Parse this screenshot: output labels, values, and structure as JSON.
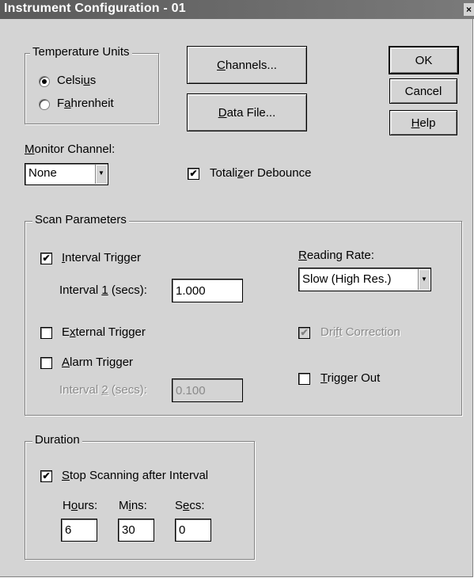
{
  "window": {
    "title": "Instrument Configuration - 01",
    "close_glyph": "×"
  },
  "temperature_units": {
    "legend": "Temperature Units",
    "celsius_pre": "Celsi",
    "celsius_key": "u",
    "celsius_post": "s",
    "fahrenheit_pre": "F",
    "fahrenheit_key": "a",
    "fahrenheit_post": "hrenheit",
    "selected": "Celsius"
  },
  "buttons": {
    "channels_key": "C",
    "channels_rest": "hannels...",
    "datafile_key": "D",
    "datafile_rest": "ata File...",
    "ok": "OK",
    "cancel": "Cancel",
    "help_key": "H",
    "help_rest": "elp"
  },
  "monitor": {
    "label_key": "M",
    "label_rest": "onitor Channel:",
    "value": "None"
  },
  "totalizer": {
    "label_pre": "Totali",
    "label_key": "z",
    "label_post": "er Debounce",
    "checked": true
  },
  "scan": {
    "legend": "Scan Parameters",
    "interval_trigger": {
      "key": "I",
      "rest": "nterval Trigger",
      "checked": true
    },
    "interval1": {
      "pre": "Interval ",
      "key": "1",
      "post": " (secs):",
      "value": "1.000"
    },
    "reading_rate": {
      "key": "R",
      "rest": "eading Rate:",
      "value": "Slow (High Res.)"
    },
    "external_trigger": {
      "pre": "E",
      "key": "x",
      "post": "ternal Trigger",
      "checked": false
    },
    "drift_correction": {
      "pre": "Dri",
      "key": "f",
      "post": "t Correction",
      "checked": true,
      "enabled": false
    },
    "alarm_trigger": {
      "key": "A",
      "rest": "larm Trigger",
      "checked": false
    },
    "trigger_out": {
      "key": "T",
      "rest": "rigger Out",
      "checked": false
    },
    "interval2": {
      "pre": "Interval ",
      "key": "2",
      "post": " (secs):",
      "value": "0.100",
      "enabled": false
    }
  },
  "duration": {
    "legend": "Duration",
    "stop_scanning": {
      "key": "S",
      "rest": "top Scanning after Interval",
      "checked": true
    },
    "hours": {
      "pre": "H",
      "key": "o",
      "post": "urs:",
      "value": "6"
    },
    "mins": {
      "pre": "M",
      "key": "i",
      "post": "ns:",
      "value": "30"
    },
    "secs": {
      "pre": "S",
      "key": "e",
      "post": "cs:",
      "value": "0"
    }
  },
  "glyphs": {
    "check": "✔",
    "dropdown_arrow": "▼"
  }
}
